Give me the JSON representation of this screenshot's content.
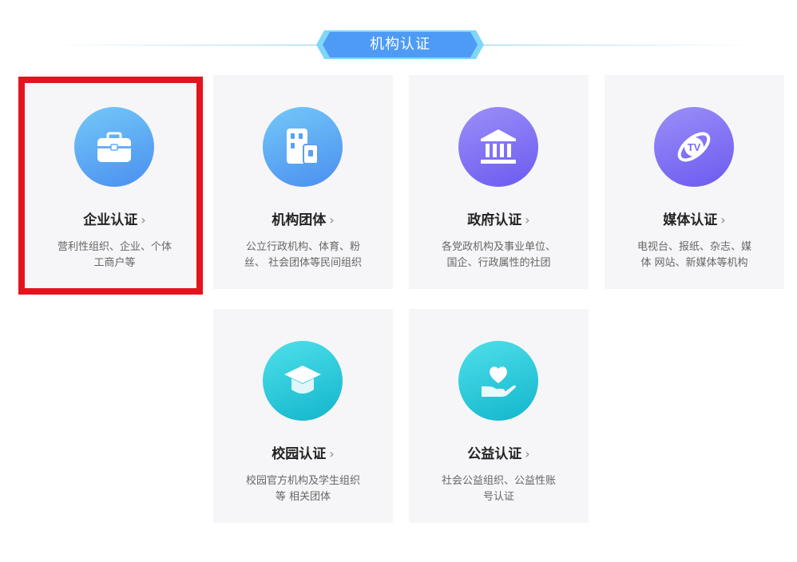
{
  "section": {
    "title": "机构认证"
  },
  "cards": [
    {
      "title": "企业认证",
      "desc_line1": "营利性组织、企业、个体",
      "desc_line2": "工商户等",
      "icon": "briefcase-icon",
      "selected": true
    },
    {
      "title": "机构团体",
      "desc_line1": "公立行政机构、体育、粉",
      "desc_line2": "丝、 社会团体等民间组织",
      "icon": "building-icon"
    },
    {
      "title": "政府认证",
      "desc_line1": "各党政机构及事业单位、",
      "desc_line2": "国企、行政属性的社团",
      "icon": "government-building-icon"
    },
    {
      "title": "媒体认证",
      "desc_line1": "电视台、报纸、杂志、媒",
      "desc_line2": "体 网站、新媒体等机构",
      "icon": "tv-icon"
    },
    {
      "title": "校园认证",
      "desc_line1": "校园官方机构及学生组织",
      "desc_line2": "等 相关团体",
      "icon": "graduation-cap-icon"
    },
    {
      "title": "公益认证",
      "desc_line1": "社会公益组织、公益性账",
      "desc_line2": "号认证",
      "icon": "heart-hand-icon"
    }
  ],
  "chevron": "›",
  "colors": {
    "selection_border": "#e3141d",
    "header_badge": "#4d9bf5",
    "card_bg": "#f6f6f8"
  }
}
